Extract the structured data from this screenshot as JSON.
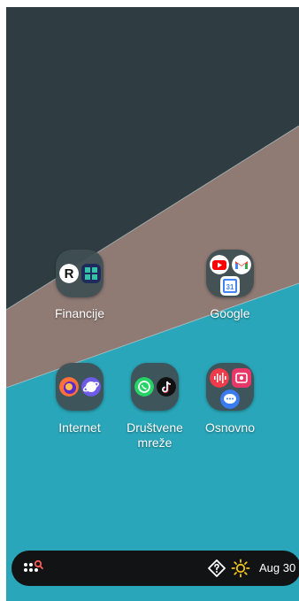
{
  "folders": [
    {
      "label": "Financije",
      "apps": [
        "revolut-icon",
        "keks-pay-icon"
      ]
    },
    {
      "label": "Google",
      "apps": [
        "youtube-icon",
        "gmail-icon",
        "google-calendar-icon"
      ]
    },
    {
      "label": "Internet",
      "apps": [
        "firefox-icon",
        "samsung-internet-icon"
      ]
    },
    {
      "label": "Društvene mreže",
      "apps": [
        "whatsapp-icon",
        "tiktok-icon"
      ]
    },
    {
      "label": "Osnovno",
      "apps": [
        "voice-recorder-icon",
        "screen-recorder-icon",
        "messages-icon"
      ]
    }
  ],
  "dock": {
    "menu_icon": "app-drawer-search-icon",
    "status_icons": [
      "help-icon",
      "sun-icon"
    ],
    "date": "Aug 30"
  },
  "colors": {
    "wallpaper_dark": "#2f3d42",
    "wallpaper_taupe": "#8f7a74",
    "wallpaper_teal": "#29a6b9",
    "folder_bg": "#3f4e52",
    "dock_bg": "#121314",
    "accent_red": "#ff5a57",
    "sun_yellow": "#f5c518"
  }
}
